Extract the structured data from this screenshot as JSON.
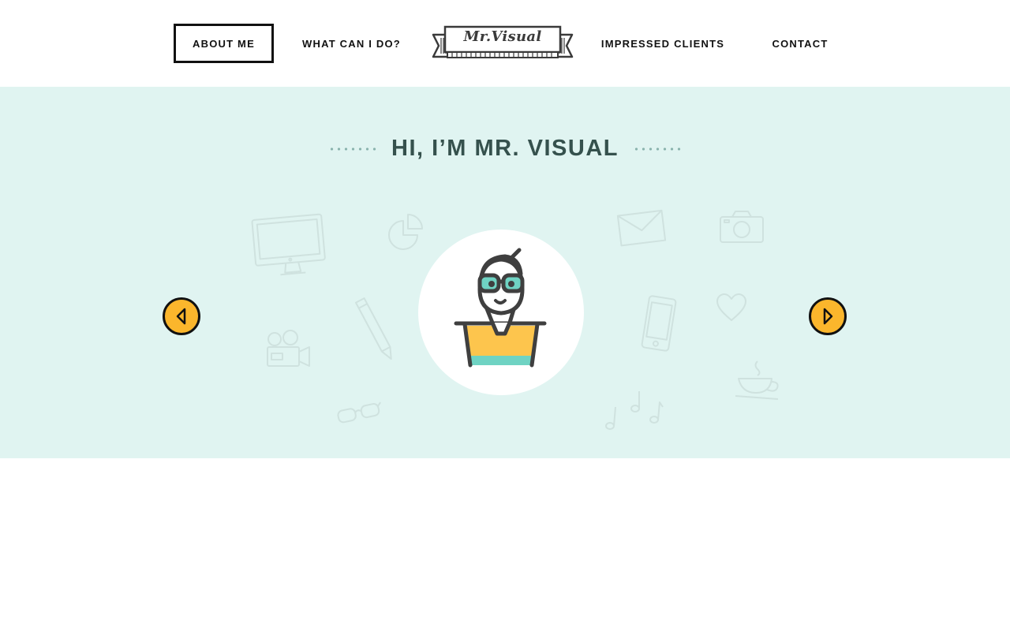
{
  "nav": {
    "about_label": "ABOUT ME",
    "what_label": "WHAT CAN I DO?",
    "logo_text": "Mr.Visual",
    "clients_label": "IMPRESSED CLIENTS",
    "contact_label": "CONTACT",
    "active_item": "about"
  },
  "hero": {
    "title": "HI, I’M MR. VISUAL",
    "background_color": "#e0f4f1",
    "title_color": "#35514d",
    "prev_icon": "chevron-left-icon",
    "next_icon": "chevron-right-icon",
    "arrow_color": "#fbb62c",
    "decorative_icons": [
      "monitor",
      "pie-chart",
      "envelope",
      "camera",
      "pencil",
      "video-camera",
      "glasses",
      "smartphone",
      "heart",
      "coffee-cup",
      "music-notes"
    ]
  },
  "avatar": {
    "icon": "nerd-avatar-icon",
    "shirt_color": "#fdc54d",
    "lens_color": "#6fd3c3"
  }
}
